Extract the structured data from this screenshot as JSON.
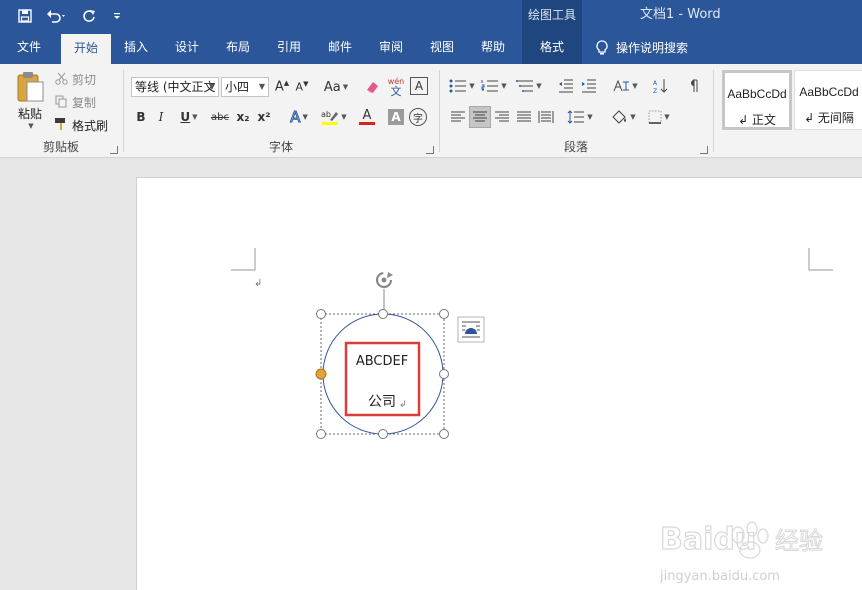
{
  "titlebar": {
    "contextual_group": "绘图工具",
    "document_title": "文档1  -  Word"
  },
  "tabs": [
    {
      "label": "文件"
    },
    {
      "label": "开始"
    },
    {
      "label": "插入"
    },
    {
      "label": "设计"
    },
    {
      "label": "布局"
    },
    {
      "label": "引用"
    },
    {
      "label": "邮件"
    },
    {
      "label": "审阅"
    },
    {
      "label": "视图"
    },
    {
      "label": "帮助"
    },
    {
      "label": "格式"
    }
  ],
  "tell_me": "操作说明搜索",
  "clipboard": {
    "label": "剪贴板",
    "paste": "粘贴",
    "cut": "剪切",
    "copy": "复制",
    "format_painter": "格式刷"
  },
  "font": {
    "label": "字体",
    "font_name": "等线 (中文正文",
    "font_size": "小四",
    "change_case": "Aa",
    "phonetic_top": "wén",
    "phonetic_bottom": "文",
    "bold": "B",
    "italic": "I",
    "underline": "U",
    "strikethrough": "abc",
    "subscript": "x₂",
    "superscript": "x²",
    "text_effect": "A",
    "font_color": "A",
    "char_shading": "A",
    "enclose": "字",
    "font_color_value": "#e02020",
    "highlight_color_value": "#ffff00"
  },
  "paragraph": {
    "label": "段落"
  },
  "styles": {
    "items": [
      {
        "sample": "AaBbCcDd",
        "name": "↲ 正文"
      },
      {
        "sample": "AaBbCcDd",
        "name": "↲ 无间隔"
      }
    ]
  },
  "document": {
    "paragraph_mark": "↲",
    "shape_text_line1": "ABCDEF",
    "shape_text_line2": "公司",
    "shape_outline_color": "#2f5597",
    "highlight_box_color": "#e03a3a"
  },
  "watermark": {
    "brand": "Baidu",
    "brand_cn": "经验",
    "url": "jingyan.baidu.com"
  }
}
